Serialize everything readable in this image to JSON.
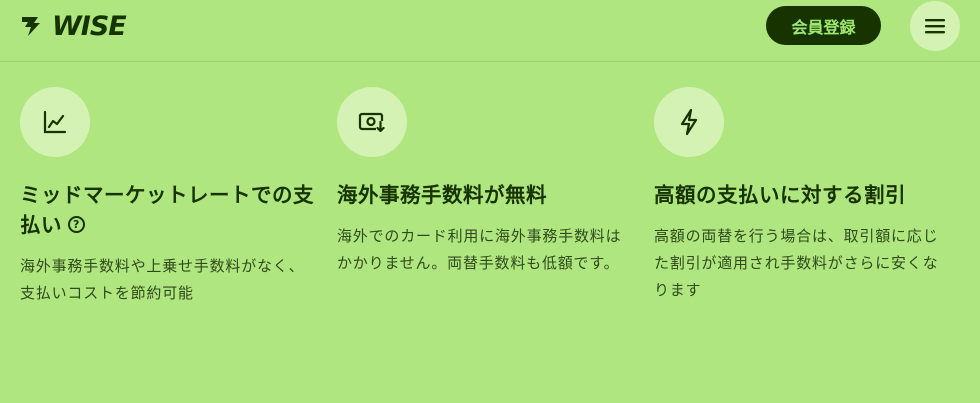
{
  "header": {
    "logo_text": "WISE",
    "signup_label": "会員登録",
    "menu_icon": "hamburger-menu-icon"
  },
  "features": [
    {
      "icon": "chart-line-icon",
      "title": "ミッドマーケットレートでの支払い",
      "has_help_icon": true,
      "help_glyph": "?",
      "description": "海外事務手数料や上乗せ手数料がなく、支払いコストを節約可能"
    },
    {
      "icon": "banknote-download-icon",
      "title": "海外事務手数料が無料",
      "description": "海外でのカード利用に海外事務手数料はかかりません。両替手数料も低額です。"
    },
    {
      "icon": "lightning-bolt-icon",
      "title": "高額の支払いに対する割引",
      "description": "高額の両替を行う場合は、取引額に応じた割引が適用され手数料がさらに安くなります"
    }
  ],
  "colors": {
    "background": "#b0e67f",
    "icon_circle": "#d3f2b3",
    "dark_green": "#163300",
    "button_text": "#9fe870"
  }
}
